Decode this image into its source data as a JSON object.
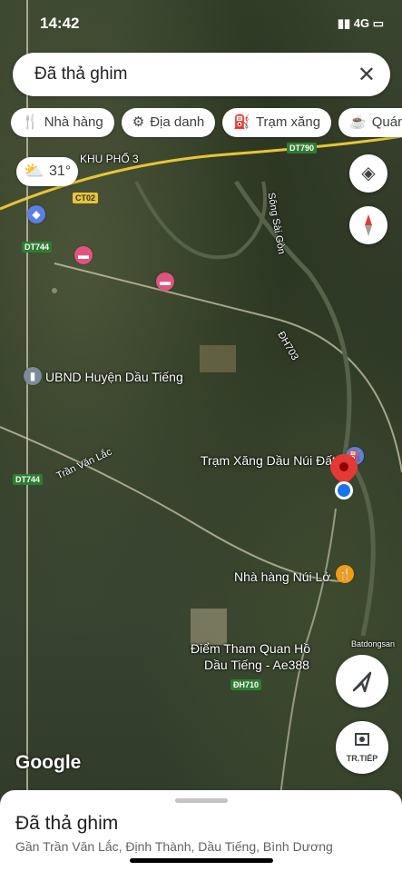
{
  "status": {
    "time": "14:42",
    "signal_text": "▮▮ 4G ▭"
  },
  "search": {
    "text": "Đã thả ghim",
    "close_icon": "close-icon"
  },
  "chips": [
    {
      "icon": "restaurant-icon",
      "glyph": "🍴",
      "label": "Nhà hàng"
    },
    {
      "icon": "landmark-icon",
      "glyph": "⚙",
      "label": "Địa danh"
    },
    {
      "icon": "gas-station-icon",
      "glyph": "⛽",
      "label": "Trạm xăng"
    },
    {
      "icon": "cafe-icon",
      "glyph": "☕",
      "label": "Quán"
    }
  ],
  "weather": {
    "temp": "31°"
  },
  "map_labels": {
    "district": "UBND Huyện Dầu Tiếng",
    "gas": "Trạm Xăng Dầu Núi Đất",
    "restaurant": "Nhà hàng Núi Lở",
    "tourist_1": "Điểm Tham Quan Hồ",
    "tourist_2": "Dầu Tiếng - Ae388",
    "khu_pho": "KHU PHỐ 3",
    "song_sai_gon": "Sông Sài Gòn",
    "tran_van_lac": "Trần Văn Lắc",
    "dh703": "ĐH703",
    "batdongsan": "Batdongsan"
  },
  "roads": {
    "dt790": "DT790",
    "ct02": "CT02",
    "dt744": "DT744",
    "dh710": "ĐH710"
  },
  "nav": {
    "tr_tiep": "TR.TIẾP"
  },
  "google": "Google",
  "sheet": {
    "title": "Đã thả ghim",
    "address": "Gần Trần Văn Lắc, Định Thành, Dầu Tiếng, Bình Dương"
  }
}
